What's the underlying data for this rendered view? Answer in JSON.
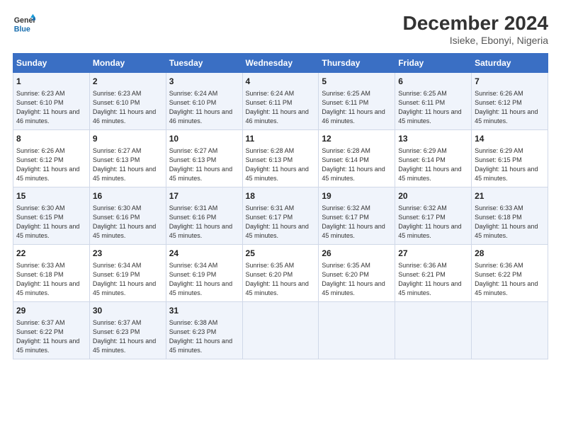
{
  "logo": {
    "line1": "General",
    "line2": "Blue"
  },
  "title": "December 2024",
  "subtitle": "Isieke, Ebonyi, Nigeria",
  "days_of_week": [
    "Sunday",
    "Monday",
    "Tuesday",
    "Wednesday",
    "Thursday",
    "Friday",
    "Saturday"
  ],
  "weeks": [
    [
      {
        "day": 1,
        "sunrise": "6:23 AM",
        "sunset": "6:10 PM",
        "daylight": "11 hours and 46 minutes."
      },
      {
        "day": 2,
        "sunrise": "6:23 AM",
        "sunset": "6:10 PM",
        "daylight": "11 hours and 46 minutes."
      },
      {
        "day": 3,
        "sunrise": "6:24 AM",
        "sunset": "6:10 PM",
        "daylight": "11 hours and 46 minutes."
      },
      {
        "day": 4,
        "sunrise": "6:24 AM",
        "sunset": "6:11 PM",
        "daylight": "11 hours and 46 minutes."
      },
      {
        "day": 5,
        "sunrise": "6:25 AM",
        "sunset": "6:11 PM",
        "daylight": "11 hours and 46 minutes."
      },
      {
        "day": 6,
        "sunrise": "6:25 AM",
        "sunset": "6:11 PM",
        "daylight": "11 hours and 45 minutes."
      },
      {
        "day": 7,
        "sunrise": "6:26 AM",
        "sunset": "6:12 PM",
        "daylight": "11 hours and 45 minutes."
      }
    ],
    [
      {
        "day": 8,
        "sunrise": "6:26 AM",
        "sunset": "6:12 PM",
        "daylight": "11 hours and 45 minutes."
      },
      {
        "day": 9,
        "sunrise": "6:27 AM",
        "sunset": "6:13 PM",
        "daylight": "11 hours and 45 minutes."
      },
      {
        "day": 10,
        "sunrise": "6:27 AM",
        "sunset": "6:13 PM",
        "daylight": "11 hours and 45 minutes."
      },
      {
        "day": 11,
        "sunrise": "6:28 AM",
        "sunset": "6:13 PM",
        "daylight": "11 hours and 45 minutes."
      },
      {
        "day": 12,
        "sunrise": "6:28 AM",
        "sunset": "6:14 PM",
        "daylight": "11 hours and 45 minutes."
      },
      {
        "day": 13,
        "sunrise": "6:29 AM",
        "sunset": "6:14 PM",
        "daylight": "11 hours and 45 minutes."
      },
      {
        "day": 14,
        "sunrise": "6:29 AM",
        "sunset": "6:15 PM",
        "daylight": "11 hours and 45 minutes."
      }
    ],
    [
      {
        "day": 15,
        "sunrise": "6:30 AM",
        "sunset": "6:15 PM",
        "daylight": "11 hours and 45 minutes."
      },
      {
        "day": 16,
        "sunrise": "6:30 AM",
        "sunset": "6:16 PM",
        "daylight": "11 hours and 45 minutes."
      },
      {
        "day": 17,
        "sunrise": "6:31 AM",
        "sunset": "6:16 PM",
        "daylight": "11 hours and 45 minutes."
      },
      {
        "day": 18,
        "sunrise": "6:31 AM",
        "sunset": "6:17 PM",
        "daylight": "11 hours and 45 minutes."
      },
      {
        "day": 19,
        "sunrise": "6:32 AM",
        "sunset": "6:17 PM",
        "daylight": "11 hours and 45 minutes."
      },
      {
        "day": 20,
        "sunrise": "6:32 AM",
        "sunset": "6:17 PM",
        "daylight": "11 hours and 45 minutes."
      },
      {
        "day": 21,
        "sunrise": "6:33 AM",
        "sunset": "6:18 PM",
        "daylight": "11 hours and 45 minutes."
      }
    ],
    [
      {
        "day": 22,
        "sunrise": "6:33 AM",
        "sunset": "6:18 PM",
        "daylight": "11 hours and 45 minutes."
      },
      {
        "day": 23,
        "sunrise": "6:34 AM",
        "sunset": "6:19 PM",
        "daylight": "11 hours and 45 minutes."
      },
      {
        "day": 24,
        "sunrise": "6:34 AM",
        "sunset": "6:19 PM",
        "daylight": "11 hours and 45 minutes."
      },
      {
        "day": 25,
        "sunrise": "6:35 AM",
        "sunset": "6:20 PM",
        "daylight": "11 hours and 45 minutes."
      },
      {
        "day": 26,
        "sunrise": "6:35 AM",
        "sunset": "6:20 PM",
        "daylight": "11 hours and 45 minutes."
      },
      {
        "day": 27,
        "sunrise": "6:36 AM",
        "sunset": "6:21 PM",
        "daylight": "11 hours and 45 minutes."
      },
      {
        "day": 28,
        "sunrise": "6:36 AM",
        "sunset": "6:22 PM",
        "daylight": "11 hours and 45 minutes."
      }
    ],
    [
      {
        "day": 29,
        "sunrise": "6:37 AM",
        "sunset": "6:22 PM",
        "daylight": "11 hours and 45 minutes."
      },
      {
        "day": 30,
        "sunrise": "6:37 AM",
        "sunset": "6:23 PM",
        "daylight": "11 hours and 45 minutes."
      },
      {
        "day": 31,
        "sunrise": "6:38 AM",
        "sunset": "6:23 PM",
        "daylight": "11 hours and 45 minutes."
      },
      null,
      null,
      null,
      null
    ]
  ]
}
